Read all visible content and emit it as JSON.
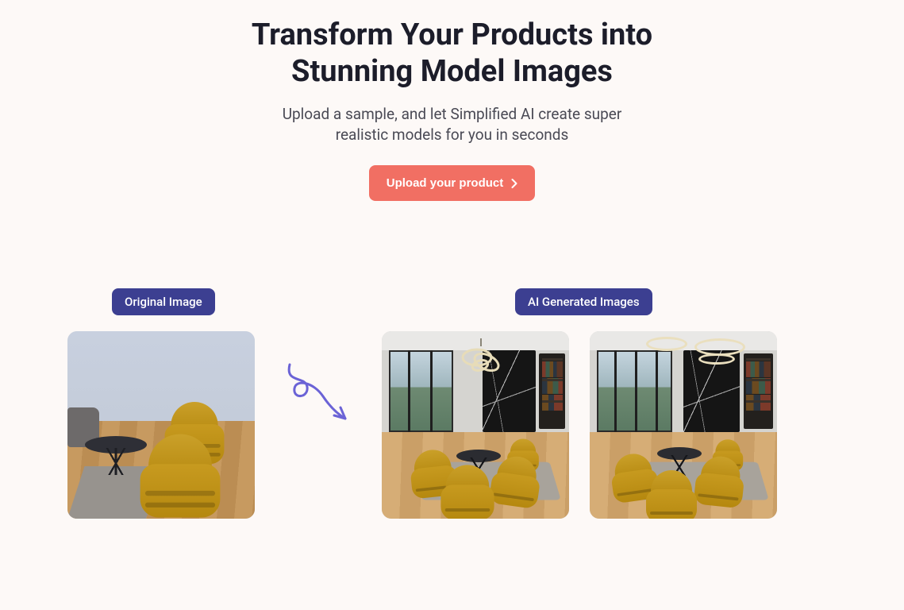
{
  "hero": {
    "title": "Transform Your Products into Stunning Model Images",
    "subtitle": "Upload a sample, and let Simplified AI create super realistic models for you in seconds",
    "cta_label": "Upload your product"
  },
  "gallery": {
    "original_badge": "Original Image",
    "generated_badge": "AI Generated Images"
  },
  "colors": {
    "cta": "#f16f63",
    "badge": "#3c3f91",
    "arrow": "#6b63d6"
  }
}
